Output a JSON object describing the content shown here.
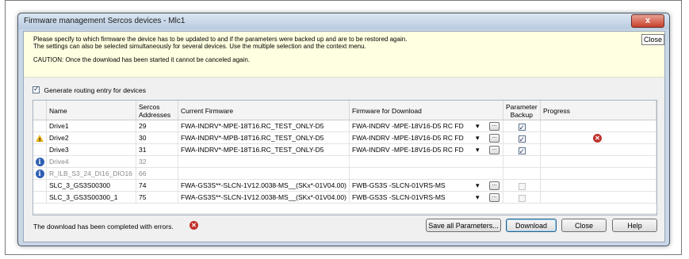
{
  "window": {
    "title": "Firmware management Sercos devices - Mlc1",
    "close_glyph": "x"
  },
  "info": {
    "line1": "Please specify to which firmware the device has to be updated to and if the parameters were backed up and are to be restored again.",
    "line2": "The settings can also be selected simultaneously for several devices. Use the multiple selection and the context menu.",
    "caution": "CAUTION: Once the download has been started it cannot be canceled again.",
    "close_tip": "Close"
  },
  "routing": {
    "label": "Generate routing entry for devices",
    "checked": true
  },
  "table": {
    "headers": {
      "name": "Name",
      "sercos_1": "Sercos",
      "sercos_2": "Addresses",
      "current": "Current Firmware",
      "download": "Firmware for Download",
      "backup_1": "Parameter",
      "backup_2": "Backup",
      "progress": "Progress"
    },
    "rows": [
      {
        "icon": "",
        "name": "Drive1",
        "address": "29",
        "current": "FWA-INDRV*-MPE-18T16.RC_TEST_ONLY-D5",
        "download": "FWA-INDRV  -MPE-18V16-D5  RC  FD",
        "has_dropdown": true,
        "backup": "checked",
        "progress": "",
        "dim": false
      },
      {
        "icon": "warning-icon",
        "name": "Drive2",
        "address": "30",
        "current": "FWA-INDRV*-MPB-18T16.RC_TEST_ONLY-D5",
        "download": "FWA-INDRV  -MPE-18V16-D5  RC  FD",
        "has_dropdown": true,
        "backup": "checked",
        "progress": "error-icon",
        "dim": false
      },
      {
        "icon": "",
        "name": "Drive3",
        "address": "31",
        "current": "FWA-INDRV*-MPE-18T16.RC_TEST_ONLY-D5",
        "download": "FWA-INDRV  -MPE-18V16-D5  RC  FD",
        "has_dropdown": true,
        "backup": "checked",
        "progress": "",
        "dim": false
      },
      {
        "icon": "info-icon",
        "name": "Drive4",
        "address": "32",
        "current": "",
        "download": "",
        "has_dropdown": false,
        "backup": "none",
        "progress": "",
        "dim": true
      },
      {
        "icon": "info-icon",
        "name": "R_ILB_S3_24_DI16_DIO16",
        "address": "66",
        "current": "",
        "download": "",
        "has_dropdown": false,
        "backup": "none",
        "progress": "",
        "dim": true
      },
      {
        "icon": "",
        "name": "SLC_3_GS3S00300",
        "address": "74",
        "current": "FWA-GS3S**-SLCN-1V12.0038-MS__(SKx*-01V04.00)",
        "download": "FWB-GS3S   -SLCN-01VRS-MS",
        "has_dropdown": true,
        "backup": "disabled",
        "progress": "",
        "dim": false
      },
      {
        "icon": "",
        "name": "SLC_3_GS3S00300_1",
        "address": "75",
        "current": "FWA-GS3S**-SLCN-1V12.0038-MS__(SKx*-01V04.00)",
        "download": "FWB-GS3S   -SLCN-01VRS-MS",
        "has_dropdown": true,
        "backup": "disabled",
        "progress": "",
        "dim": false
      }
    ]
  },
  "status": {
    "text": "The download has been completed with errors."
  },
  "buttons": {
    "save_all": "Save all Parameters...",
    "download": "Download",
    "close": "Close",
    "help": "Help",
    "ellipsis": "...",
    "dropdown_arrow": "▾"
  }
}
